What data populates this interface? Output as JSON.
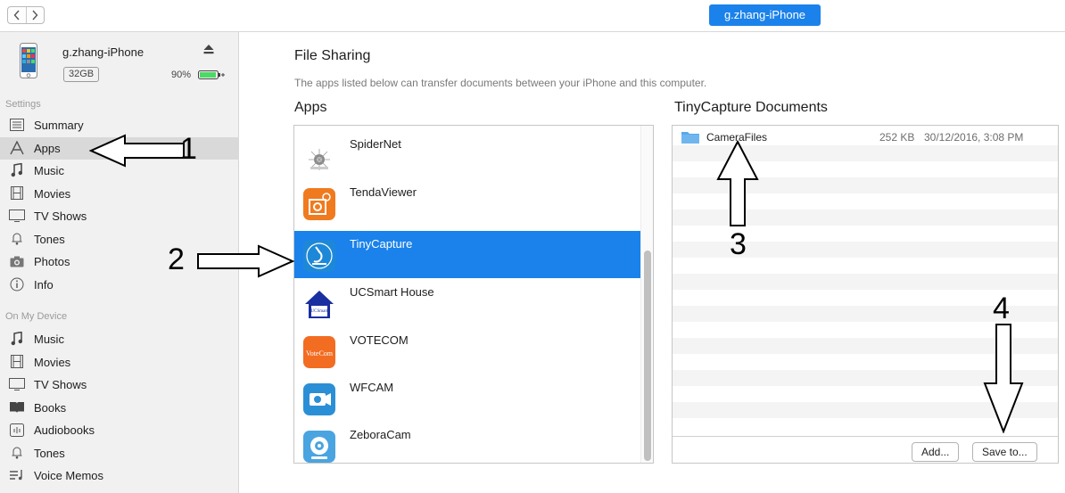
{
  "toolbar": {
    "back_icon": "chevron-left-icon",
    "forward_icon": "chevron-right-icon",
    "device_pill": "g.zhang-iPhone"
  },
  "device": {
    "name": "g.zhang-iPhone",
    "capacity": "32GB",
    "battery": "90%"
  },
  "sidebar": {
    "settings_label": "Settings",
    "settings_items": [
      {
        "label": "Summary",
        "icon": "list-icon"
      },
      {
        "label": "Apps",
        "icon": "apps-icon",
        "selected": true
      },
      {
        "label": "Music",
        "icon": "music-note-icon"
      },
      {
        "label": "Movies",
        "icon": "film-icon"
      },
      {
        "label": "TV Shows",
        "icon": "tv-icon"
      },
      {
        "label": "Tones",
        "icon": "bell-icon"
      },
      {
        "label": "Photos",
        "icon": "camera-icon"
      },
      {
        "label": "Info",
        "icon": "info-icon"
      }
    ],
    "device_label": "On My Device",
    "device_items": [
      {
        "label": "Music",
        "icon": "music-note-icon"
      },
      {
        "label": "Movies",
        "icon": "film-icon"
      },
      {
        "label": "TV Shows",
        "icon": "tv-icon"
      },
      {
        "label": "Books",
        "icon": "book-icon"
      },
      {
        "label": "Audiobooks",
        "icon": "audiobook-icon"
      },
      {
        "label": "Tones",
        "icon": "bell-icon"
      },
      {
        "label": "Voice Memos",
        "icon": "voice-memo-icon"
      }
    ]
  },
  "main": {
    "title": "File Sharing",
    "description": "The apps listed below can transfer documents between your iPhone and this computer.",
    "apps_heading": "Apps",
    "apps": [
      {
        "name": "SpiderNet",
        "color": "#ffffff"
      },
      {
        "name": "TendaViewer",
        "color": "#f07a1e"
      },
      {
        "name": "TinyCapture",
        "color": "#1e88d8",
        "selected": true
      },
      {
        "name": "UCSmart House",
        "color": "#ffffff"
      },
      {
        "name": "VOTECOM",
        "color": "#f26c22"
      },
      {
        "name": "WFCAM",
        "color": "#2b8fd6"
      },
      {
        "name": "ZeboraCam",
        "color": "#4aa4e0"
      }
    ],
    "docs_heading": "TinyCapture Documents",
    "documents": [
      {
        "name": "CameraFiles",
        "size": "252 KB",
        "date": "30/12/2016, 3:08 PM"
      }
    ],
    "add_button": "Add...",
    "save_button": "Save to..."
  },
  "annotations": [
    "1",
    "2",
    "3",
    "4"
  ],
  "colors": {
    "accent": "#1a82ea",
    "folder": "#5aa9ea"
  }
}
